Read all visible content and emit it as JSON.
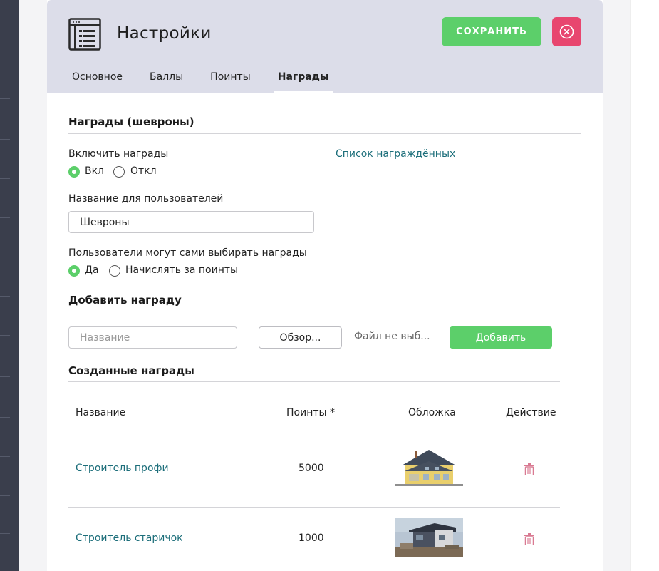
{
  "header": {
    "title": "Настройки",
    "save_label": "СОХРАНИТЬ",
    "tabs": [
      {
        "label": "Основное",
        "active": false
      },
      {
        "label": "Баллы",
        "active": false
      },
      {
        "label": "Поинты",
        "active": false
      },
      {
        "label": "Награды",
        "active": true
      }
    ]
  },
  "awards_section": {
    "title": "Награды (шевроны)",
    "enable_label": "Включить награды",
    "enable_options": [
      {
        "label": "Вкл",
        "selected": true
      },
      {
        "label": "Откл",
        "selected": false
      }
    ],
    "awarded_list_link": "Список награждённых",
    "display_name_label": "Название для пользователей",
    "display_name_value": "Шевроны",
    "self_choose_label": "Пользователи могут сами выбирать награды",
    "self_choose_options": [
      {
        "label": "Да",
        "selected": true
      },
      {
        "label": "Начислять за поинты",
        "selected": false
      }
    ]
  },
  "add_award": {
    "title": "Добавить награду",
    "name_placeholder": "Название",
    "browse_label": "Обзор...",
    "file_status": "Файл не выб...",
    "add_label": "Добавить"
  },
  "created_awards": {
    "title": "Созданные награды",
    "columns": [
      "Название",
      "Поинты *",
      "Обложка",
      "Действие"
    ],
    "rows": [
      {
        "name": "Строитель профи",
        "points": "5000",
        "cover": "house-yellow-image",
        "action": "trash-icon"
      },
      {
        "name": "Строитель старичок",
        "points": "1000",
        "cover": "house-grey-image",
        "action": "trash-icon"
      }
    ]
  },
  "colors": {
    "accent_green": "#5ccf6a",
    "close_red": "#e8466f",
    "link_teal": "#1c6e7a",
    "header_bg": "#dcdde9",
    "trash_pink": "#d97a92"
  }
}
